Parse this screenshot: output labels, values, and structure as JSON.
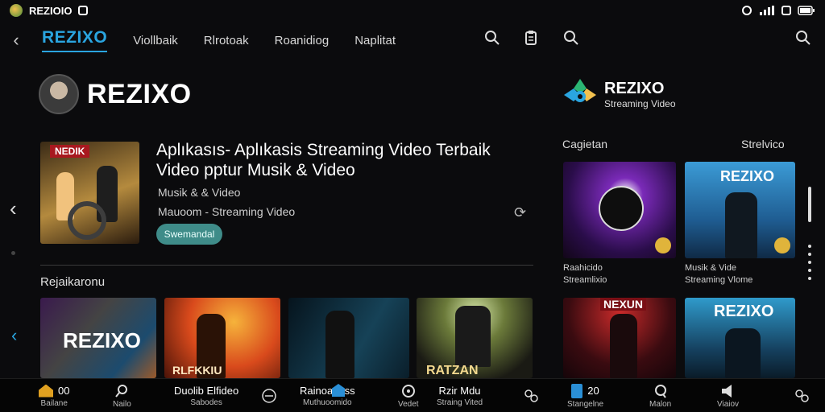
{
  "status": {
    "left_text": "REZIOIO",
    "right_text": ""
  },
  "nav": {
    "brand": "REZIXO",
    "tabs": [
      "Viollbaik",
      "Rlrotoak",
      "Roanidiog",
      "Naplitat"
    ]
  },
  "hero": {
    "brand_name": "REZIXO",
    "poster_tag": "NEDIK",
    "title": "Aplıkasıs- Aplıkasis Streaming Video Terbaik Video pptur Musik & Video",
    "subtitle1": "Musik & & Video",
    "subtitle2": "Mauoom - Streaming Video",
    "button_label": "Swemandal"
  },
  "left_section": {
    "heading": "Rejaikaronu",
    "thumbs": [
      "REZIXO",
      "RLFKKIU",
      "",
      "RATZAN"
    ]
  },
  "right_panel": {
    "brand_name": "REZIXO",
    "brand_sub": "Streaming Video",
    "section_left": "Cagietan",
    "section_right": "Strelvico",
    "cards": [
      {
        "caption": "",
        "label1": "Raahicido",
        "label2": "Streamlixio"
      },
      {
        "caption": "REZIXO",
        "label1": "Musik & Vide",
        "label2": "Streaming Vlome"
      },
      {
        "caption": "NEXUN",
        "label1": "",
        "label2": ""
      },
      {
        "caption": "REZIXO",
        "label1": "",
        "label2": ""
      }
    ]
  },
  "bottom_bar": [
    {
      "top": "00",
      "label": "Bailane"
    },
    {
      "top": "",
      "label": "Nailo"
    },
    {
      "top": "Duolib Elfideo",
      "label": "Sabodes"
    },
    {
      "top": "",
      "label": ""
    },
    {
      "top": "Rainoanass",
      "label": "Muthuoomido"
    },
    {
      "top": "",
      "label": "Vedet"
    },
    {
      "top": "Rzir Mdu",
      "label": "Straing Vited"
    },
    {
      "top": "",
      "label": ""
    },
    {
      "top": "20",
      "label": "Stangelne"
    },
    {
      "top": "",
      "label": "Malon"
    },
    {
      "top": "",
      "label": "Viaiov"
    },
    {
      "top": "",
      "label": ""
    }
  ],
  "colors": {
    "accent": "#2aa5e0",
    "button": "#3f8c89",
    "background": "#0b0b0d"
  }
}
